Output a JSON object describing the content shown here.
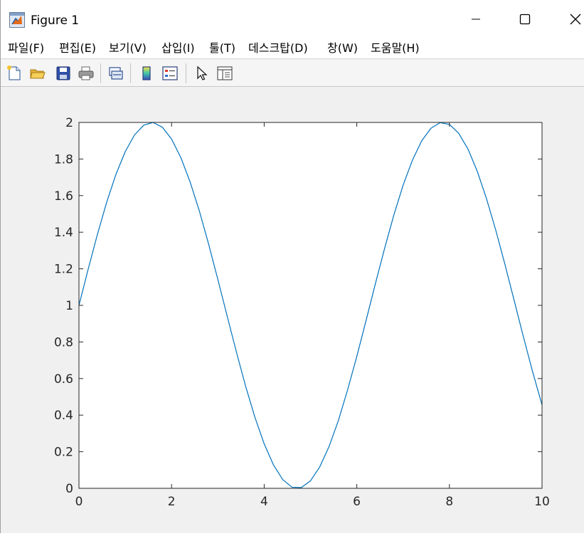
{
  "window": {
    "title": "Figure 1",
    "icon": "matlab-figure-icon",
    "controls": [
      "minimize-icon",
      "maximize-icon",
      "close-icon"
    ]
  },
  "menu": {
    "items": [
      {
        "label": "파일(F)"
      },
      {
        "label": "편집(E)"
      },
      {
        "label": "보기(V)"
      },
      {
        "label": "삽입(I)"
      },
      {
        "label": "툴(T)"
      },
      {
        "label": "데스크탑(D)"
      },
      {
        "label": "창(W)"
      },
      {
        "label": "도움말(H)"
      }
    ]
  },
  "toolbar": {
    "buttons": [
      {
        "icon": "new-figure-icon"
      },
      {
        "icon": "open-file-icon"
      },
      {
        "icon": "save-icon"
      },
      {
        "icon": "print-icon"
      },
      {
        "icon": "link-plot-icon"
      },
      {
        "icon": "insert-colorbar-icon"
      },
      {
        "icon": "insert-legend-icon"
      },
      {
        "icon": "edit-plot-cursor-icon"
      },
      {
        "icon": "property-inspector-icon"
      }
    ]
  },
  "colors": {
    "line": "#0072bd",
    "axes_bg": "#ffffff",
    "figure_bg": "#f0f0f0"
  },
  "chart_data": {
    "type": "line",
    "title": "",
    "xlabel": "",
    "ylabel": "",
    "xlim": [
      0,
      10
    ],
    "ylim": [
      0,
      2
    ],
    "xticks": [
      "0",
      "2",
      "4",
      "6",
      "8",
      "10"
    ],
    "yticks": [
      "0",
      "0.2",
      "0.4",
      "0.6",
      "0.8",
      "1",
      "1.2",
      "1.4",
      "1.6",
      "1.8",
      "2"
    ],
    "grid": false,
    "x": [
      0,
      0.2,
      0.4,
      0.6,
      0.8,
      1.0,
      1.2,
      1.4,
      1.6,
      1.8,
      2.0,
      2.2,
      2.4,
      2.6,
      2.8,
      3.0,
      3.2,
      3.4,
      3.6,
      3.8,
      4.0,
      4.2,
      4.4,
      4.6,
      4.8,
      5.0,
      5.2,
      5.4,
      5.6,
      5.8,
      6.0,
      6.2,
      6.4,
      6.6,
      6.8,
      7.0,
      7.2,
      7.4,
      7.6,
      7.8,
      8.0,
      8.2,
      8.4,
      8.6,
      8.8,
      9.0,
      9.2,
      9.4,
      9.6,
      9.8,
      10.0
    ],
    "series": [
      {
        "values": [
          1.0,
          1.199,
          1.389,
          1.565,
          1.717,
          1.841,
          1.932,
          1.985,
          2.0,
          1.974,
          1.909,
          1.808,
          1.675,
          1.516,
          1.335,
          1.141,
          0.942,
          0.745,
          0.557,
          0.388,
          0.243,
          0.128,
          0.048,
          0.006,
          0.004,
          0.041,
          0.117,
          0.228,
          0.369,
          0.537,
          0.721,
          0.917,
          1.117,
          1.311,
          1.494,
          1.657,
          1.793,
          1.899,
          1.968,
          1.999,
          1.989,
          1.941,
          1.855,
          1.734,
          1.584,
          1.412,
          1.223,
          1.025,
          0.826,
          0.634,
          0.456
        ]
      }
    ]
  }
}
